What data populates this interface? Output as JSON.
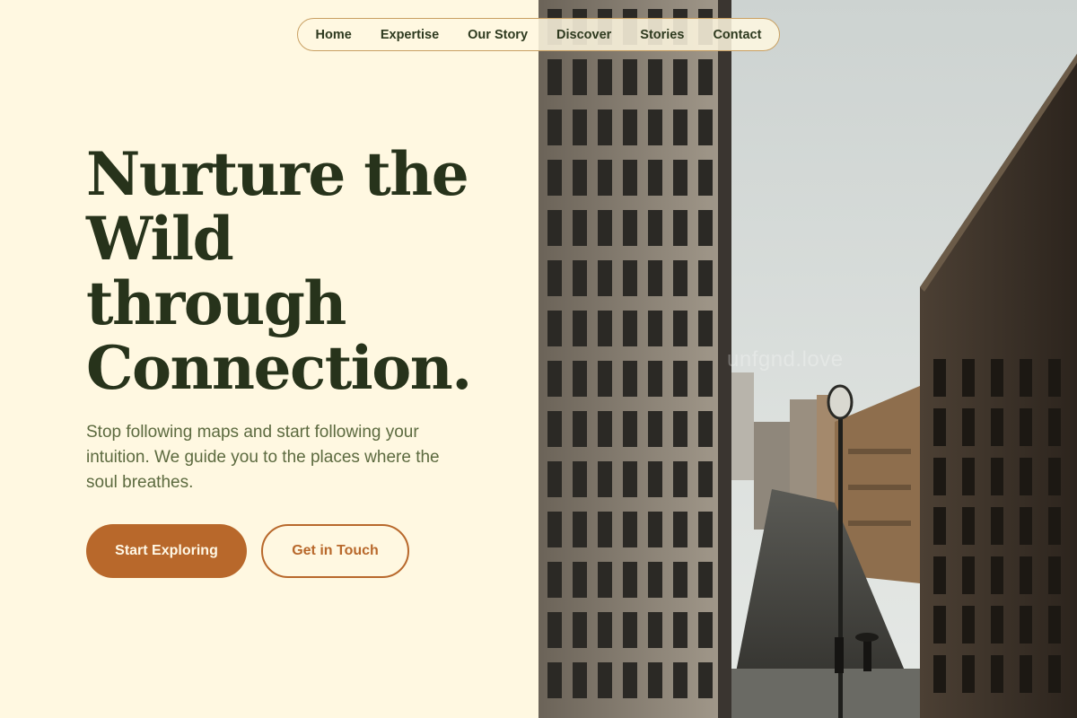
{
  "nav": {
    "items": [
      {
        "label": "Home"
      },
      {
        "label": "Expertise"
      },
      {
        "label": "Our Story"
      },
      {
        "label": "Discover"
      },
      {
        "label": "Stories"
      },
      {
        "label": "Contact"
      }
    ]
  },
  "hero": {
    "title_lines": [
      "Nurture the",
      "Wild",
      "through",
      "Connection."
    ],
    "subtitle": "Stop following maps and start following your intuition. We guide you to the places where the soul breathes.",
    "primary_button": "Start Exploring",
    "secondary_button": "Get in Touch"
  },
  "image": {
    "watermark": "unfgnd.love"
  },
  "colors": {
    "background": "#fff8e1",
    "heading": "#27331b",
    "subtitle": "#5c6a3f",
    "accent": "#b8682b"
  }
}
